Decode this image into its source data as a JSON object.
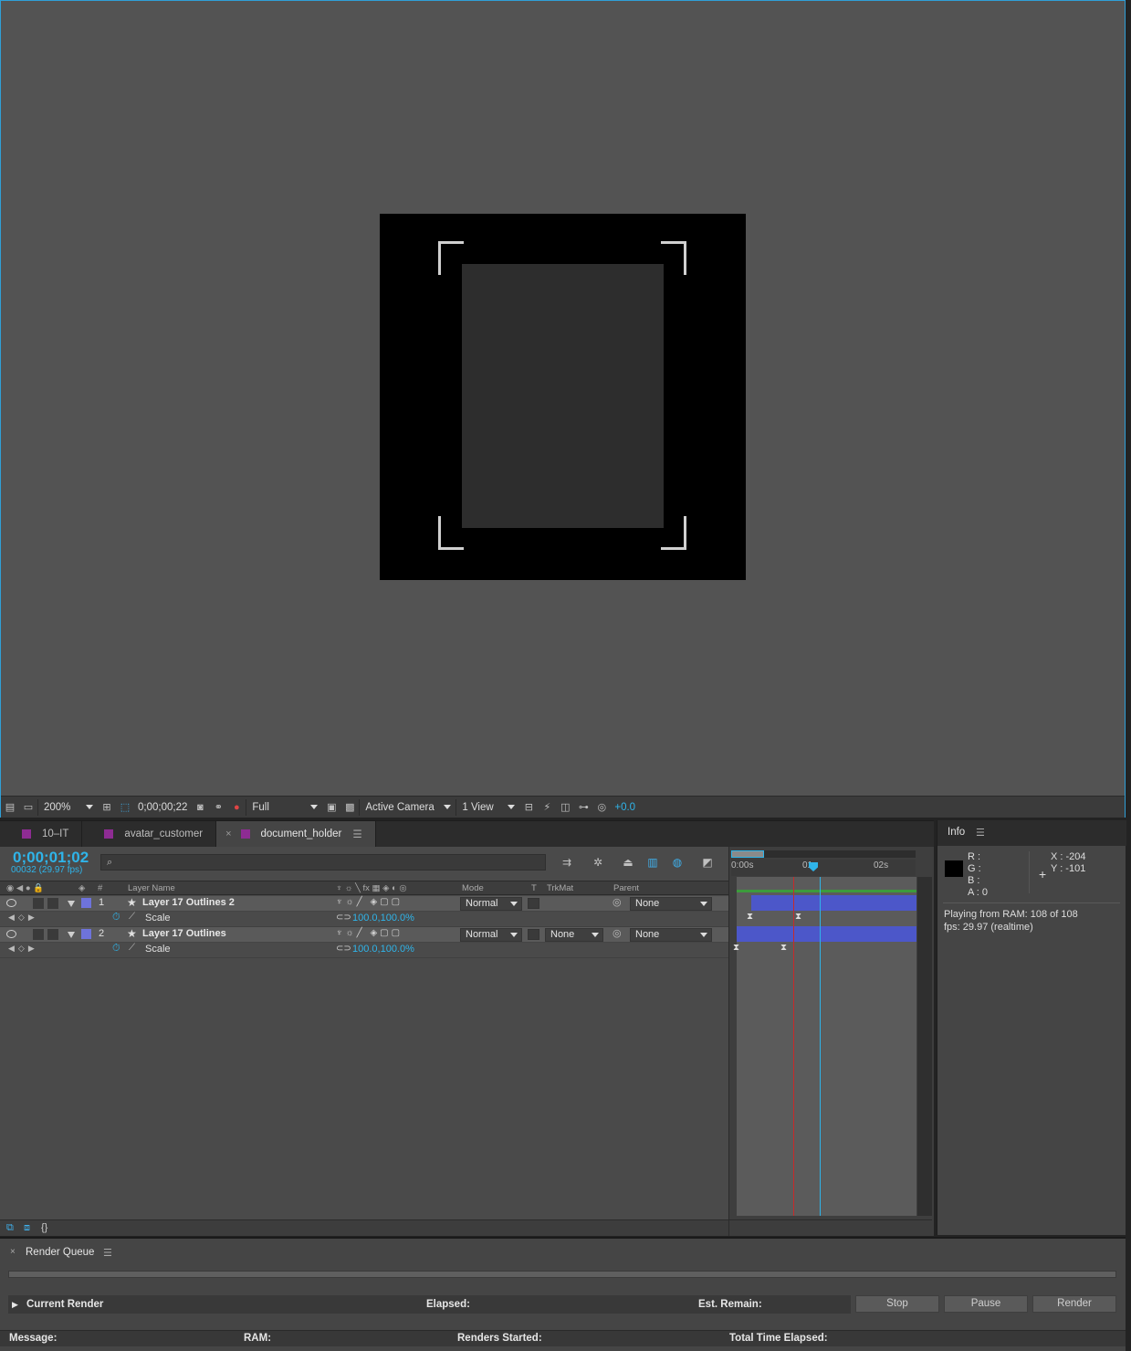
{
  "viewer": {
    "zoom": "200%",
    "timecode": "0;00;00;22",
    "resolution": "Full",
    "camera": "Active Camera",
    "views": "1 View",
    "exposure": "+0.0"
  },
  "tabs": [
    {
      "label": "10–IT",
      "active": false
    },
    {
      "label": "avatar_customer",
      "active": false
    },
    {
      "label": "document_holder",
      "active": true
    }
  ],
  "timeline": {
    "current_time": "0;00;01;02",
    "frames": "00032 (29.97 fps)",
    "search_placeholder": "",
    "columns": {
      "layer_name": "Layer Name",
      "hash": "#",
      "mode": "Mode",
      "t": "T",
      "trkmat": "TrkMat",
      "parent": "Parent"
    },
    "layers": [
      {
        "num": "1",
        "name": "Layer 17 Outlines 2",
        "mode": "Normal",
        "trkmat": "",
        "parent": "None",
        "prop": "Scale",
        "value": "100.0,100.0%"
      },
      {
        "num": "2",
        "name": "Layer 17 Outlines",
        "mode": "Normal",
        "trkmat": "None",
        "parent": "None",
        "prop": "Scale",
        "value": "100.0,100.0%"
      }
    ],
    "ruler": {
      "t0": "0:00s",
      "t1": "01s",
      "t2": "02s"
    }
  },
  "info": {
    "title": "Info",
    "r": "R :",
    "g": "G :",
    "b": "B :",
    "a": "A : 0",
    "x": "X : -204",
    "y": "Y : -101",
    "line1": "Playing from RAM: 108 of 108",
    "line2": "fps: 29.97 (realtime)"
  },
  "render_queue": {
    "title": "Render Queue",
    "current_render": "Current Render",
    "elapsed": "Elapsed:",
    "est_remain": "Est. Remain:",
    "stop": "Stop",
    "pause": "Pause",
    "render": "Render",
    "message": "Message:",
    "ram": "RAM:",
    "renders_started": "Renders Started:",
    "total_time_elapsed": "Total Time Elapsed:"
  },
  "colors": {
    "accent": "#2fb4e9",
    "label_purple": "#8e2c93",
    "layer_label": "#6e73db",
    "layer_bar": "#4c57c9"
  }
}
